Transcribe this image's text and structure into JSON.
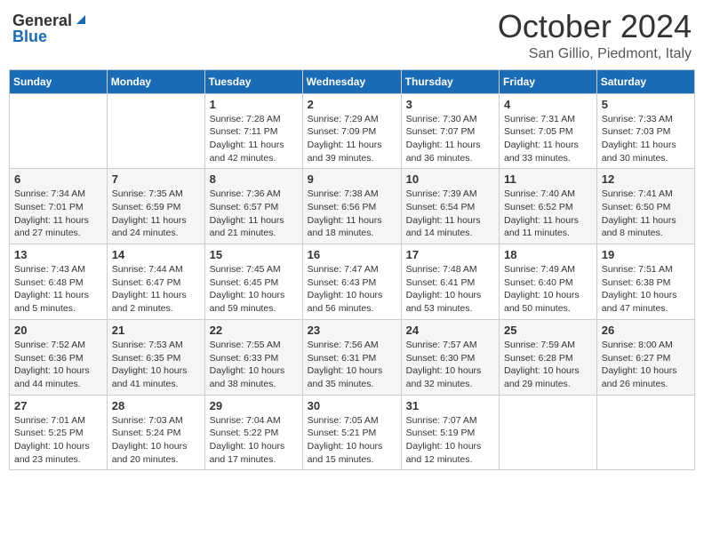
{
  "header": {
    "logo_general": "General",
    "logo_blue": "Blue",
    "title": "October 2024",
    "location": "San Gillio, Piedmont, Italy"
  },
  "weekdays": [
    "Sunday",
    "Monday",
    "Tuesday",
    "Wednesday",
    "Thursday",
    "Friday",
    "Saturday"
  ],
  "weeks": [
    [
      {
        "day": "",
        "sunrise": "",
        "sunset": "",
        "daylight": ""
      },
      {
        "day": "",
        "sunrise": "",
        "sunset": "",
        "daylight": ""
      },
      {
        "day": "1",
        "sunrise": "Sunrise: 7:28 AM",
        "sunset": "Sunset: 7:11 PM",
        "daylight": "Daylight: 11 hours and 42 minutes."
      },
      {
        "day": "2",
        "sunrise": "Sunrise: 7:29 AM",
        "sunset": "Sunset: 7:09 PM",
        "daylight": "Daylight: 11 hours and 39 minutes."
      },
      {
        "day": "3",
        "sunrise": "Sunrise: 7:30 AM",
        "sunset": "Sunset: 7:07 PM",
        "daylight": "Daylight: 11 hours and 36 minutes."
      },
      {
        "day": "4",
        "sunrise": "Sunrise: 7:31 AM",
        "sunset": "Sunset: 7:05 PM",
        "daylight": "Daylight: 11 hours and 33 minutes."
      },
      {
        "day": "5",
        "sunrise": "Sunrise: 7:33 AM",
        "sunset": "Sunset: 7:03 PM",
        "daylight": "Daylight: 11 hours and 30 minutes."
      }
    ],
    [
      {
        "day": "6",
        "sunrise": "Sunrise: 7:34 AM",
        "sunset": "Sunset: 7:01 PM",
        "daylight": "Daylight: 11 hours and 27 minutes."
      },
      {
        "day": "7",
        "sunrise": "Sunrise: 7:35 AM",
        "sunset": "Sunset: 6:59 PM",
        "daylight": "Daylight: 11 hours and 24 minutes."
      },
      {
        "day": "8",
        "sunrise": "Sunrise: 7:36 AM",
        "sunset": "Sunset: 6:57 PM",
        "daylight": "Daylight: 11 hours and 21 minutes."
      },
      {
        "day": "9",
        "sunrise": "Sunrise: 7:38 AM",
        "sunset": "Sunset: 6:56 PM",
        "daylight": "Daylight: 11 hours and 18 minutes."
      },
      {
        "day": "10",
        "sunrise": "Sunrise: 7:39 AM",
        "sunset": "Sunset: 6:54 PM",
        "daylight": "Daylight: 11 hours and 14 minutes."
      },
      {
        "day": "11",
        "sunrise": "Sunrise: 7:40 AM",
        "sunset": "Sunset: 6:52 PM",
        "daylight": "Daylight: 11 hours and 11 minutes."
      },
      {
        "day": "12",
        "sunrise": "Sunrise: 7:41 AM",
        "sunset": "Sunset: 6:50 PM",
        "daylight": "Daylight: 11 hours and 8 minutes."
      }
    ],
    [
      {
        "day": "13",
        "sunrise": "Sunrise: 7:43 AM",
        "sunset": "Sunset: 6:48 PM",
        "daylight": "Daylight: 11 hours and 5 minutes."
      },
      {
        "day": "14",
        "sunrise": "Sunrise: 7:44 AM",
        "sunset": "Sunset: 6:47 PM",
        "daylight": "Daylight: 11 hours and 2 minutes."
      },
      {
        "day": "15",
        "sunrise": "Sunrise: 7:45 AM",
        "sunset": "Sunset: 6:45 PM",
        "daylight": "Daylight: 10 hours and 59 minutes."
      },
      {
        "day": "16",
        "sunrise": "Sunrise: 7:47 AM",
        "sunset": "Sunset: 6:43 PM",
        "daylight": "Daylight: 10 hours and 56 minutes."
      },
      {
        "day": "17",
        "sunrise": "Sunrise: 7:48 AM",
        "sunset": "Sunset: 6:41 PM",
        "daylight": "Daylight: 10 hours and 53 minutes."
      },
      {
        "day": "18",
        "sunrise": "Sunrise: 7:49 AM",
        "sunset": "Sunset: 6:40 PM",
        "daylight": "Daylight: 10 hours and 50 minutes."
      },
      {
        "day": "19",
        "sunrise": "Sunrise: 7:51 AM",
        "sunset": "Sunset: 6:38 PM",
        "daylight": "Daylight: 10 hours and 47 minutes."
      }
    ],
    [
      {
        "day": "20",
        "sunrise": "Sunrise: 7:52 AM",
        "sunset": "Sunset: 6:36 PM",
        "daylight": "Daylight: 10 hours and 44 minutes."
      },
      {
        "day": "21",
        "sunrise": "Sunrise: 7:53 AM",
        "sunset": "Sunset: 6:35 PM",
        "daylight": "Daylight: 10 hours and 41 minutes."
      },
      {
        "day": "22",
        "sunrise": "Sunrise: 7:55 AM",
        "sunset": "Sunset: 6:33 PM",
        "daylight": "Daylight: 10 hours and 38 minutes."
      },
      {
        "day": "23",
        "sunrise": "Sunrise: 7:56 AM",
        "sunset": "Sunset: 6:31 PM",
        "daylight": "Daylight: 10 hours and 35 minutes."
      },
      {
        "day": "24",
        "sunrise": "Sunrise: 7:57 AM",
        "sunset": "Sunset: 6:30 PM",
        "daylight": "Daylight: 10 hours and 32 minutes."
      },
      {
        "day": "25",
        "sunrise": "Sunrise: 7:59 AM",
        "sunset": "Sunset: 6:28 PM",
        "daylight": "Daylight: 10 hours and 29 minutes."
      },
      {
        "day": "26",
        "sunrise": "Sunrise: 8:00 AM",
        "sunset": "Sunset: 6:27 PM",
        "daylight": "Daylight: 10 hours and 26 minutes."
      }
    ],
    [
      {
        "day": "27",
        "sunrise": "Sunrise: 7:01 AM",
        "sunset": "Sunset: 5:25 PM",
        "daylight": "Daylight: 10 hours and 23 minutes."
      },
      {
        "day": "28",
        "sunrise": "Sunrise: 7:03 AM",
        "sunset": "Sunset: 5:24 PM",
        "daylight": "Daylight: 10 hours and 20 minutes."
      },
      {
        "day": "29",
        "sunrise": "Sunrise: 7:04 AM",
        "sunset": "Sunset: 5:22 PM",
        "daylight": "Daylight: 10 hours and 17 minutes."
      },
      {
        "day": "30",
        "sunrise": "Sunrise: 7:05 AM",
        "sunset": "Sunset: 5:21 PM",
        "daylight": "Daylight: 10 hours and 15 minutes."
      },
      {
        "day": "31",
        "sunrise": "Sunrise: 7:07 AM",
        "sunset": "Sunset: 5:19 PM",
        "daylight": "Daylight: 10 hours and 12 minutes."
      },
      {
        "day": "",
        "sunrise": "",
        "sunset": "",
        "daylight": ""
      },
      {
        "day": "",
        "sunrise": "",
        "sunset": "",
        "daylight": ""
      }
    ]
  ]
}
